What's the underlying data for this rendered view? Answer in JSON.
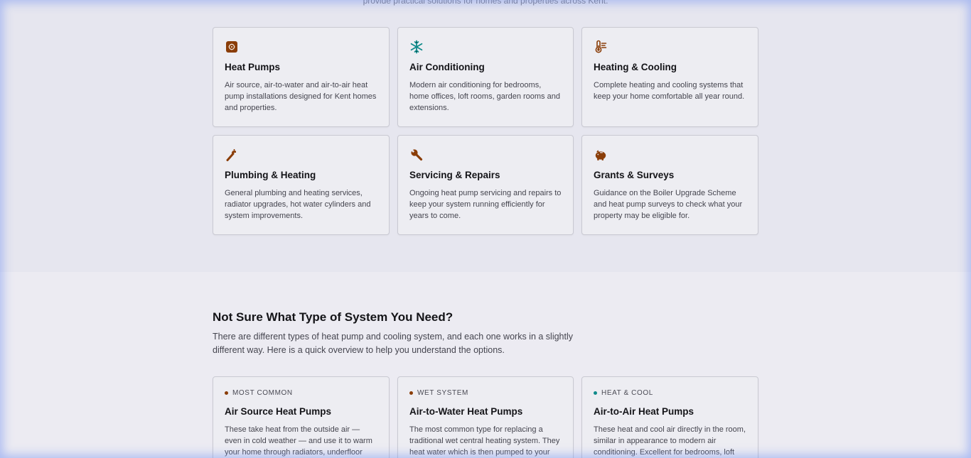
{
  "intro": {
    "tail_text": "provide practical solutions for homes and properties across Kent."
  },
  "colors": {
    "accent_brown": "#8a3d08",
    "accent_teal": "#0f8a8a"
  },
  "services": [
    {
      "icon": "heat-pump-icon",
      "title": "Heat Pumps",
      "desc": "Air source, air-to-water and air-to-air heat pump installations designed for Kent homes and properties."
    },
    {
      "icon": "snowflake-icon",
      "title": "Air Conditioning",
      "desc": "Modern air conditioning for bedrooms, home offices, loft rooms, garden rooms and extensions."
    },
    {
      "icon": "thermometer-icon",
      "title": "Heating & Cooling",
      "desc": "Complete heating and cooling systems that keep your home comfortable all year round."
    },
    {
      "icon": "pipe-wrench-icon",
      "title": "Plumbing & Heating",
      "desc": "General plumbing and heating services, radiator upgrades, hot water cylinders and system improvements."
    },
    {
      "icon": "wrench-icon",
      "title": "Servicing & Repairs",
      "desc": "Ongoing heat pump servicing and repairs to keep your system running efficiently for years to come."
    },
    {
      "icon": "piggy-bank-icon",
      "title": "Grants & Surveys",
      "desc": "Guidance on the Boiler Upgrade Scheme and heat pump surveys to check what your property may be eligible for."
    }
  ],
  "system_types": {
    "title": "Not Sure What Type of System You Need?",
    "subtitle": "There are different types of heat pump and cooling system, and each one works in a slightly different way. Here is a quick overview to help you understand the options.",
    "cards": [
      {
        "tag": "MOST COMMON",
        "dot_color": "#8a3d08",
        "title": "Air Source Heat Pumps",
        "desc": "These take heat from the outside air — even in cold weather — and use it to warm your home through radiators, underfloor heating"
      },
      {
        "tag": "WET SYSTEM",
        "dot_color": "#8a3d08",
        "title": "Air-to-Water Heat Pumps",
        "desc": "The most common type for replacing a traditional wet central heating system. They heat water which is then pumped to your"
      },
      {
        "tag": "HEAT & COOL",
        "dot_color": "#0f8a8a",
        "title": "Air-to-Air Heat Pumps",
        "desc": "These heat and cool air directly in the room, similar in appearance to modern air conditioning. Excellent for bedrooms, loft"
      }
    ]
  }
}
